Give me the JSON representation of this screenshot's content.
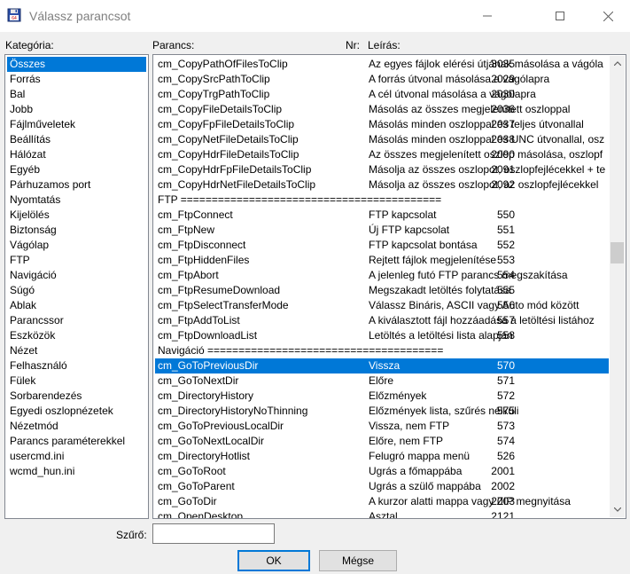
{
  "window": {
    "title": "Válassz parancsot",
    "minimize": "—",
    "maximize": "☐",
    "close": "✕"
  },
  "labels": {
    "category": "Kategória:",
    "command": "Parancs:",
    "nr": "Nr:",
    "description": "Leírás:",
    "filter": "Szűrő:"
  },
  "categories": [
    {
      "label": "Összes",
      "selected": true
    },
    {
      "label": "Forrás"
    },
    {
      "label": "Bal"
    },
    {
      "label": "Jobb"
    },
    {
      "label": "Fájlműveletek"
    },
    {
      "label": "Beállítás"
    },
    {
      "label": "Hálózat"
    },
    {
      "label": "Egyéb"
    },
    {
      "label": "Párhuzamos port"
    },
    {
      "label": "Nyomtatás"
    },
    {
      "label": "Kijelölés"
    },
    {
      "label": "Biztonság"
    },
    {
      "label": "Vágólap"
    },
    {
      "label": "FTP"
    },
    {
      "label": "Navigáció"
    },
    {
      "label": "Súgó"
    },
    {
      "label": "Ablak"
    },
    {
      "label": "Parancssor"
    },
    {
      "label": "Eszközök"
    },
    {
      "label": "Nézet"
    },
    {
      "label": "Felhasználó"
    },
    {
      "label": "Fülek"
    },
    {
      "label": "Sorbarendezés"
    },
    {
      "label": "Egyedi oszlopnézetek"
    },
    {
      "label": "Nézetmód"
    },
    {
      "label": "Parancs paraméterekkel"
    },
    {
      "label": "usercmd.ini"
    },
    {
      "label": "wcmd_hun.ini"
    }
  ],
  "commands": [
    {
      "name": "cm_CopyPathOfFilesToClip",
      "nr": "3035",
      "desc": "Az egyes fájlok elérési útjának másolása a vágóla"
    },
    {
      "name": "cm_CopySrcPathToClip",
      "nr": "2029",
      "desc": "A forrás útvonal másolása a vágólapra"
    },
    {
      "name": "cm_CopyTrgPathToClip",
      "nr": "2030",
      "desc": "A cél útvonal másolása a vágólapra"
    },
    {
      "name": "cm_CopyFileDetailsToClip",
      "nr": "2036",
      "desc": "Másolás az összes megjelenített oszloppal"
    },
    {
      "name": "cm_CopyFpFileDetailsToClip",
      "nr": "2037",
      "desc": "Másolás minden oszloppal és teljes útvonallal"
    },
    {
      "name": "cm_CopyNetFileDetailsToClip",
      "nr": "2038",
      "desc": "Másolás minden oszloppal és UNC útvonallal, osz"
    },
    {
      "name": "cm_CopyHdrFileDetailsToClip",
      "nr": "2090",
      "desc": "Az összes megjelenített oszlop másolása, oszlopf"
    },
    {
      "name": "cm_CopyHdrFpFileDetailsToClip",
      "nr": "2091",
      "desc": "Másolja az összes oszlopot, oszlopfejlécekkel + te"
    },
    {
      "name": "cm_CopyHdrNetFileDetailsToClip",
      "nr": "2092",
      "desc": "Másolja az összes oszlopot, az oszlopfejlécekkel"
    },
    {
      "separator": "FTP =========================================="
    },
    {
      "name": "cm_FtpConnect",
      "nr": "550",
      "desc": "FTP kapcsolat"
    },
    {
      "name": "cm_FtpNew",
      "nr": "551",
      "desc": "Új FTP kapcsolat"
    },
    {
      "name": "cm_FtpDisconnect",
      "nr": "552",
      "desc": "FTP kapcsolat bontása"
    },
    {
      "name": "cm_FtpHiddenFiles",
      "nr": "553",
      "desc": "Rejtett fájlok megjelenítése"
    },
    {
      "name": "cm_FtpAbort",
      "nr": "554",
      "desc": "A jelenleg futó FTP parancs megszakítása"
    },
    {
      "name": "cm_FtpResumeDownload",
      "nr": "555",
      "desc": "Megszakadt letöltés folytatása"
    },
    {
      "name": "cm_FtpSelectTransferMode",
      "nr": "556",
      "desc": "Válassz Bináris, ASCII vagy Auto mód között"
    },
    {
      "name": "cm_FtpAddToList",
      "nr": "557",
      "desc": "A kiválasztott fájl hozzáadása a letöltési listához"
    },
    {
      "name": "cm_FtpDownloadList",
      "nr": "558",
      "desc": "Letöltés a letöltési lista alapján"
    },
    {
      "separator": "Navigáció ======================================"
    },
    {
      "name": "cm_GoToPreviousDir",
      "nr": "570",
      "desc": "Vissza",
      "selected": true
    },
    {
      "name": "cm_GoToNextDir",
      "nr": "571",
      "desc": "Előre"
    },
    {
      "name": "cm_DirectoryHistory",
      "nr": "572",
      "desc": "Előzmények"
    },
    {
      "name": "cm_DirectoryHistoryNoThinning",
      "nr": "575",
      "desc": "Előzmények lista, szűrés nélküli"
    },
    {
      "name": "cm_GoToPreviousLocalDir",
      "nr": "573",
      "desc": "Vissza, nem FTP"
    },
    {
      "name": "cm_GoToNextLocalDir",
      "nr": "574",
      "desc": "Előre, nem FTP"
    },
    {
      "name": "cm_DirectoryHotlist",
      "nr": "526",
      "desc": "Felugró mappa menü"
    },
    {
      "name": "cm_GoToRoot",
      "nr": "2001",
      "desc": "Ugrás a főmappába"
    },
    {
      "name": "cm_GoToParent",
      "nr": "2002",
      "desc": "Ugrás a szülő mappába"
    },
    {
      "name": "cm_GoToDir",
      "nr": "2003",
      "desc": "A kurzor alatti mappa vagy ZIP megnyitása"
    },
    {
      "name": "cm_OpenDesktop",
      "nr": "2121",
      "desc": "Asztal"
    }
  ],
  "filter": {
    "value": ""
  },
  "buttons": {
    "ok": "OK",
    "cancel": "Mégse"
  },
  "colors": {
    "selection": "#0078d7"
  },
  "icons": {
    "app": "floppy-disk-icon",
    "scroll_up": "chevron-up-icon",
    "scroll_down": "chevron-down-icon"
  }
}
